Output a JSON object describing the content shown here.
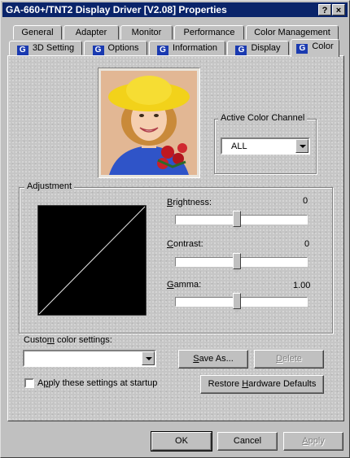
{
  "window": {
    "title": "GA-660+/TNT2 Display Driver [V2.08] Properties",
    "help_glyph": "?",
    "close_glyph": "×"
  },
  "tabs_row1": [
    "General",
    "Adapter",
    "Monitor",
    "Performance",
    "Color Management"
  ],
  "tabs_row2": [
    "3D Setting",
    "Options",
    "Information",
    "Display",
    "Color"
  ],
  "tab_icon_glyph": "G",
  "active_tab": "Color",
  "active_channel": {
    "label": "Active Color Channel",
    "selected": "ALL"
  },
  "adjustment": {
    "label": "Adjustment",
    "brightness": {
      "label": "Brightness:",
      "value": "0",
      "level": 0.5
    },
    "contrast": {
      "label": "Contrast:",
      "value": "0",
      "level": 0.5
    },
    "gamma": {
      "label": "Gamma:",
      "value": "1.00",
      "level": 0.5
    }
  },
  "custom": {
    "label": "Custom color settings:",
    "selected": ""
  },
  "buttons": {
    "save_as": "Save As...",
    "delete": "Delete",
    "restore": "Restore Hardware Defaults",
    "ok": "OK",
    "cancel": "Cancel",
    "apply": "Apply"
  },
  "startup_checkbox": {
    "label": "Apply these settings at startup",
    "checked": false
  },
  "colors": {
    "titlebar": "#0a246a",
    "hat_yellow": "#f2d21a",
    "shirt_blue": "#2f54c8",
    "rose_red": "#c01820"
  }
}
